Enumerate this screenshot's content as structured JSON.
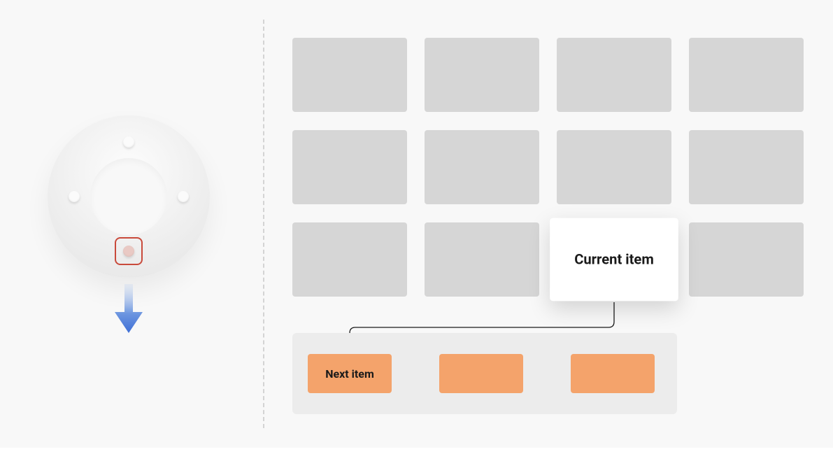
{
  "dpad": {
    "active_direction": "down"
  },
  "grid": {
    "current_label": "Current item"
  },
  "next_row": {
    "items": [
      {
        "label": "Next item"
      },
      {
        "label": ""
      },
      {
        "label": ""
      }
    ]
  }
}
